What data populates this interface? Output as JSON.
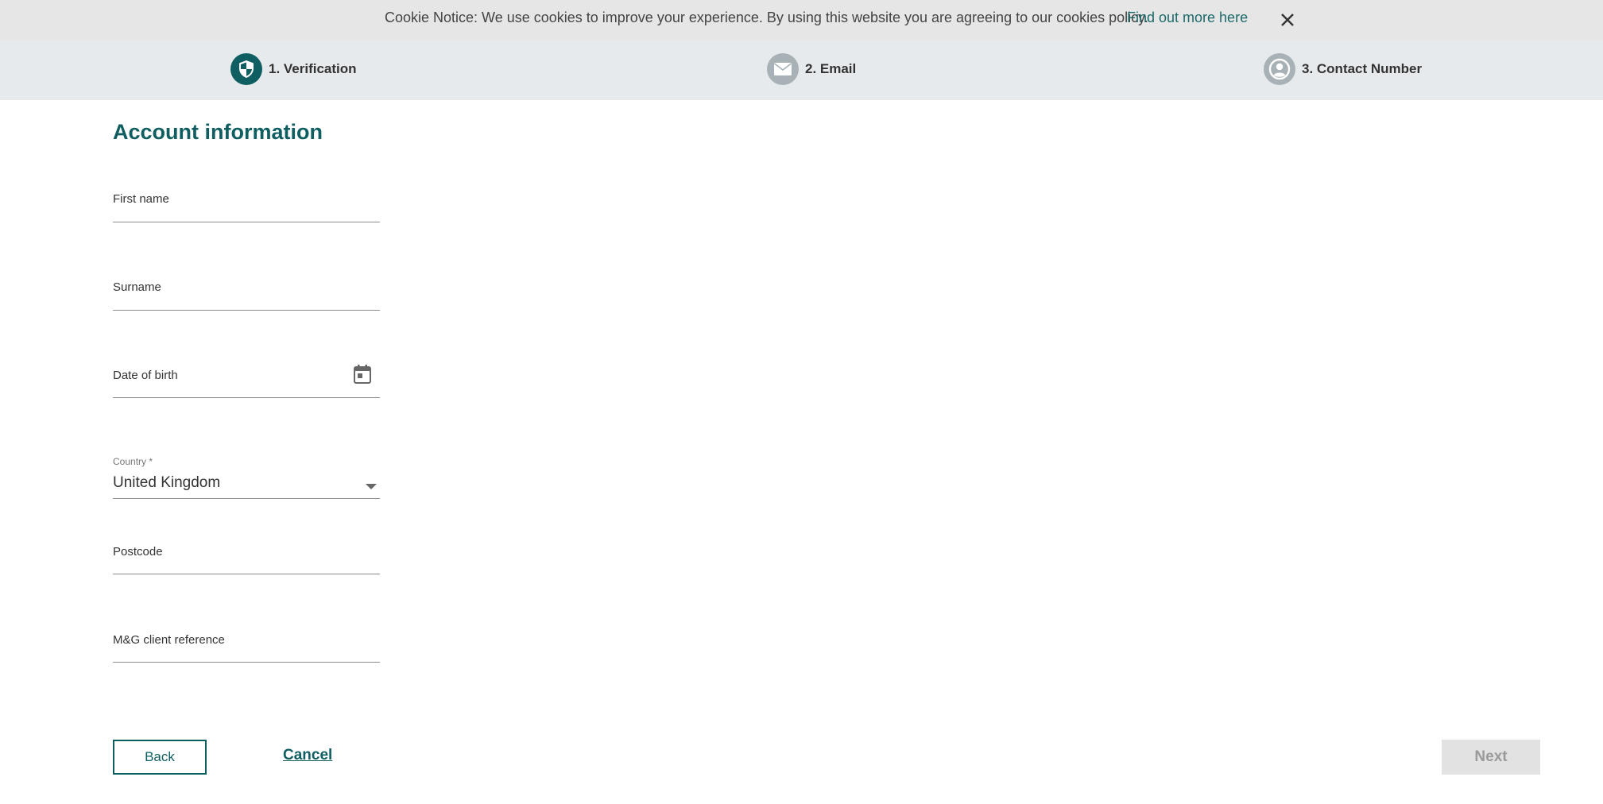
{
  "cookie": {
    "text": "Cookie Notice: We use cookies to improve your experience. By using this website you are agreeing to our cookies policy.",
    "link": "Find out more here"
  },
  "steps": [
    {
      "label": "1. Verification",
      "icon": "shield-icon",
      "state": "active"
    },
    {
      "label": "2. Email",
      "icon": "envelope-icon",
      "state": "inactive"
    },
    {
      "label": "3. Contact Number",
      "icon": "user-icon",
      "state": "inactive"
    }
  ],
  "colors": {
    "brand": "#0f5e61",
    "step_inactive": "#a7b1b6",
    "cookie_bg": "#e6e6e6",
    "steps_bg": "#e7eaec"
  },
  "form": {
    "title": "Account information",
    "first_name_label": "First name",
    "surname_label": "Surname",
    "dob_label": "Date of birth",
    "country_label": "Country *",
    "country_value": "United Kingdom",
    "postcode_label": "Postcode",
    "client_ref_label": "M&G client reference"
  },
  "actions": {
    "back": "Back",
    "cancel": "Cancel",
    "next": "Next"
  }
}
